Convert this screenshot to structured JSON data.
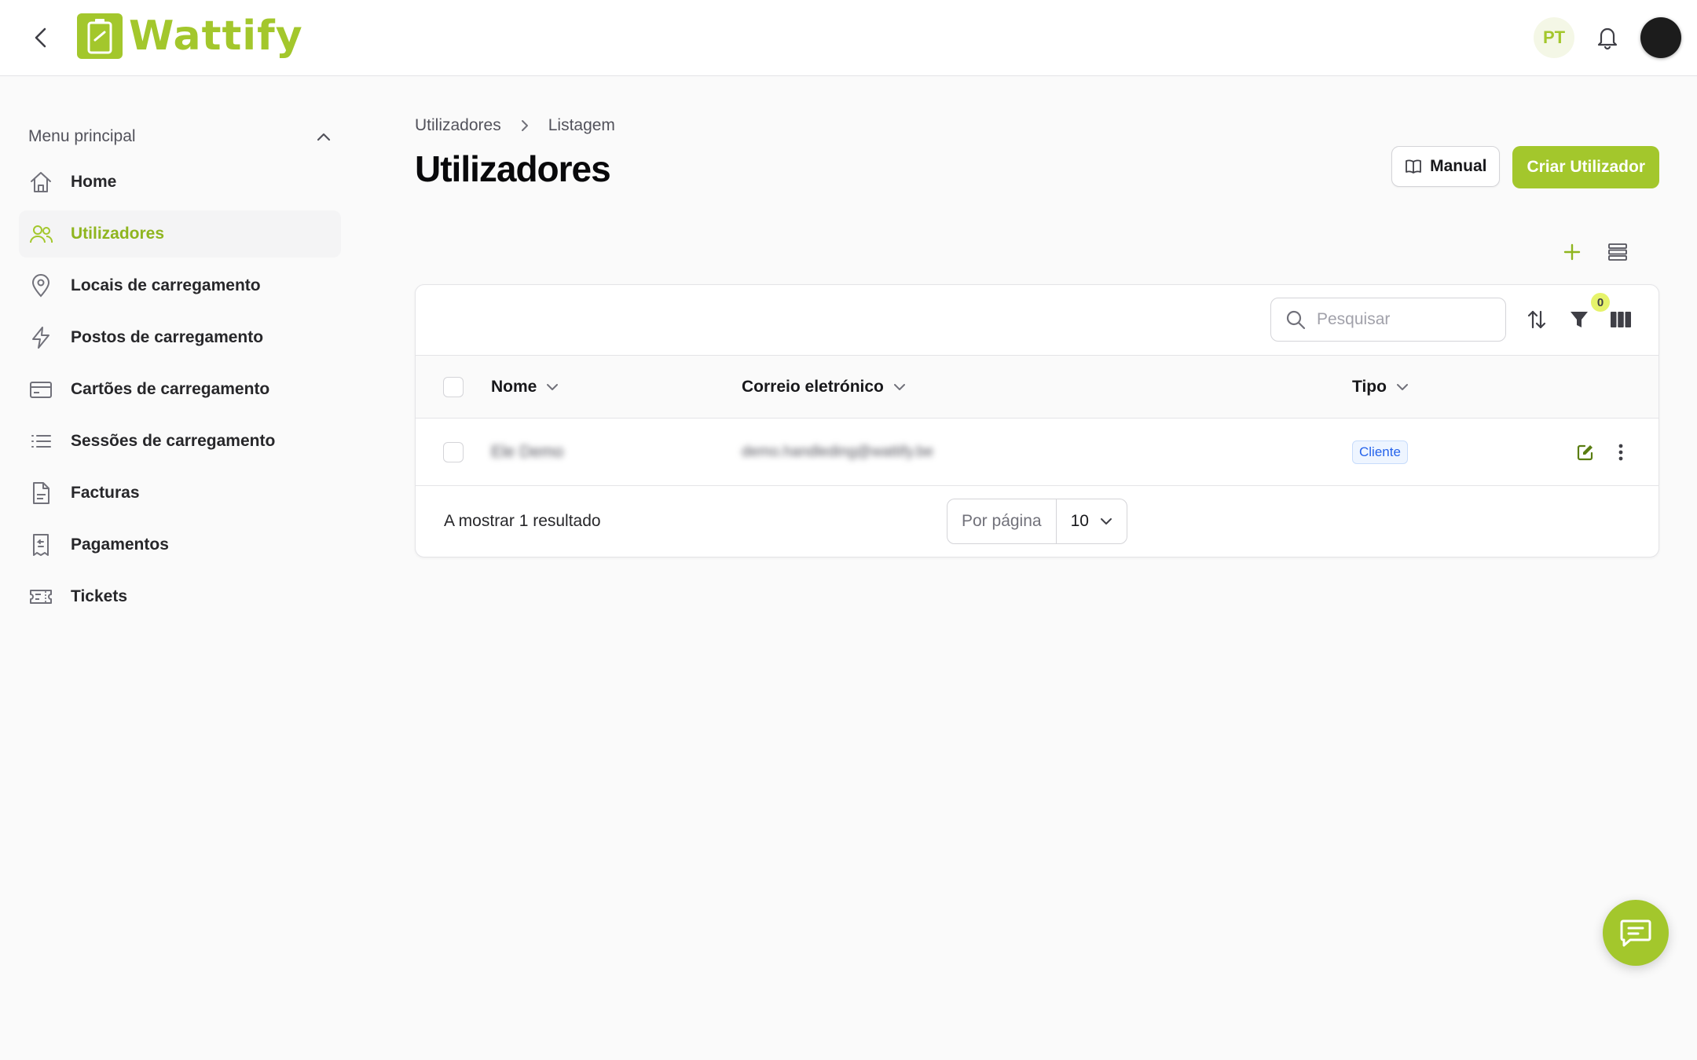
{
  "header": {
    "app_name": "Wattify",
    "language": "PT"
  },
  "sidebar": {
    "title": "Menu principal",
    "items": [
      {
        "label": "Home",
        "icon": "home-icon",
        "active": false
      },
      {
        "label": "Utilizadores",
        "icon": "users-icon",
        "active": true
      },
      {
        "label": "Locais de carregamento",
        "icon": "map-pin-icon",
        "active": false
      },
      {
        "label": "Postos de carregamento",
        "icon": "lightning-icon",
        "active": false
      },
      {
        "label": "Cartões de carregamento",
        "icon": "credit-card-icon",
        "active": false
      },
      {
        "label": "Sessões de carregamento",
        "icon": "list-icon",
        "active": false
      },
      {
        "label": "Facturas",
        "icon": "document-icon",
        "active": false
      },
      {
        "label": "Pagamentos",
        "icon": "receipt-icon",
        "active": false
      },
      {
        "label": "Tickets",
        "icon": "ticket-icon",
        "active": false
      }
    ]
  },
  "breadcrumb": {
    "items": [
      "Utilizadores",
      "Listagem"
    ]
  },
  "page": {
    "title": "Utilizadores",
    "manual_label": "Manual",
    "create_label": "Criar Utilizador"
  },
  "table": {
    "search_placeholder": "Pesquisar",
    "filter_count": "0",
    "columns": [
      "Nome",
      "Correio eletrónico",
      "Tipo"
    ],
    "rows": [
      {
        "name": "Ele Demo",
        "email": "demo.handleding@wattify.be",
        "type": "Cliente"
      }
    ],
    "result_text": "A mostrar 1 resultado",
    "per_page_label": "Por página",
    "per_page_value": "10"
  },
  "colors": {
    "brand": "#a3c72c",
    "badge_text": "#2563eb",
    "badge_bg": "#eef5ff"
  }
}
